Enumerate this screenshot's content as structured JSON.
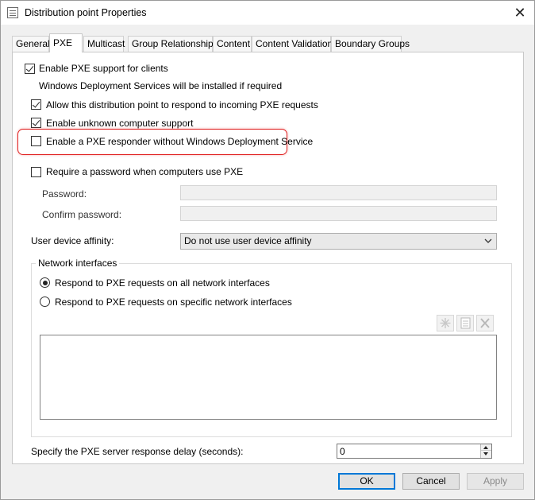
{
  "window": {
    "title": "Distribution point Properties",
    "close_glyph": "✕"
  },
  "tabs": [
    {
      "label": "General"
    },
    {
      "label": "PXE"
    },
    {
      "label": "Multicast"
    },
    {
      "label": "Group Relationships"
    },
    {
      "label": "Content"
    },
    {
      "label": "Content Validation"
    },
    {
      "label": "Boundary Groups"
    }
  ],
  "active_tab": "PXE",
  "pxe": {
    "enable_pxe": {
      "label": "Enable PXE support for clients",
      "checked": true
    },
    "wds_note": "Windows Deployment Services will be installed if required",
    "allow_respond": {
      "label": "Allow this distribution point to respond to incoming PXE requests",
      "checked": true
    },
    "unknown_support": {
      "label": "Enable unknown computer support",
      "checked": true
    },
    "pxe_responder": {
      "label": "Enable a PXE responder without Windows Deployment Service",
      "checked": false
    },
    "require_password": {
      "label": "Require a password when computers use PXE",
      "checked": false
    },
    "password_label": "Password:",
    "confirm_password_label": "Confirm password:",
    "user_affinity_label": "User device affinity:",
    "user_affinity_value": "Do not use user device affinity",
    "network_interfaces": {
      "title": "Network interfaces",
      "option_all": "Respond to PXE requests on all network interfaces",
      "option_specific": "Respond to PXE requests on specific network interfaces",
      "selected": "all"
    },
    "delay_label": "Specify the PXE server response delay (seconds):",
    "delay_value": "0"
  },
  "buttons": {
    "ok": "OK",
    "cancel": "Cancel",
    "apply": "Apply"
  },
  "colors": {
    "highlight": "#e02020",
    "default_button_border": "#0078d7"
  }
}
